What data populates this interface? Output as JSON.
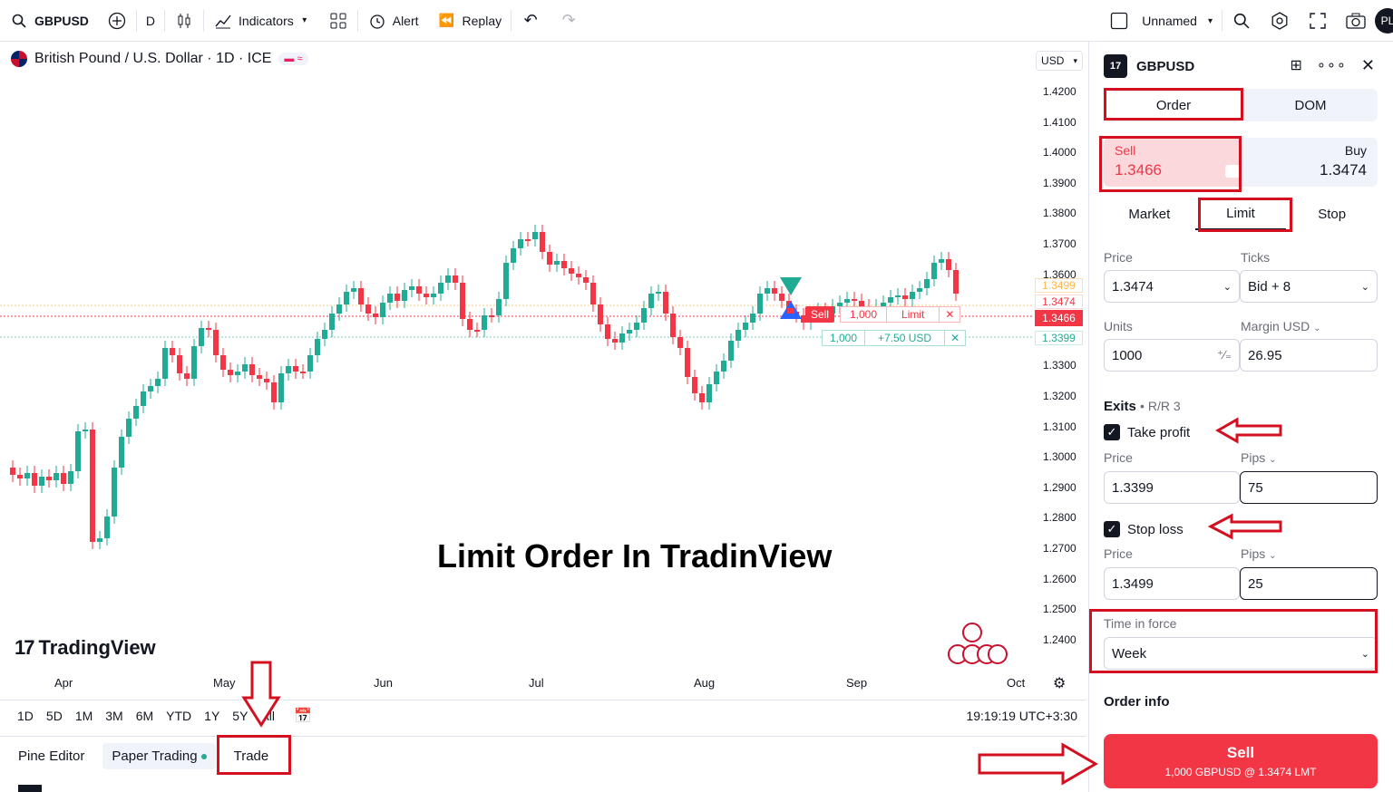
{
  "toolbar": {
    "symbol": "GBPUSD",
    "interval": "D",
    "indicators": "Indicators",
    "alert": "Alert",
    "replay": "Replay",
    "layout": "Unnamed",
    "profile": "PL"
  },
  "legend": {
    "title": "British Pound / U.S. Dollar · 1D · ICE",
    "currency": "USD"
  },
  "price_axis": [
    "1.4200",
    "1.4100",
    "1.4000",
    "1.3900",
    "1.3800",
    "1.3700",
    "1.3600",
    "1.3300",
    "1.3200",
    "1.3100",
    "1.3000",
    "1.2900",
    "1.2800",
    "1.2700",
    "1.2600",
    "1.2500",
    "1.2400"
  ],
  "price_tags": {
    "take_profit": "1.3399",
    "limit": "1.3474",
    "current": "1.3466",
    "stop_loss": "1.3499"
  },
  "chart_lines": {
    "sell_label": "Sell",
    "limit_qty": "1,000",
    "limit_label": "Limit",
    "tp_qty": "1,000",
    "tp_value": "+7.50 USD"
  },
  "months": [
    "Apr",
    "May",
    "Jun",
    "Jul",
    "Aug",
    "Sep",
    "Oct"
  ],
  "watermark": "TradingView",
  "overlay_title": "Limit Order In TradinView",
  "ranges": [
    "1D",
    "5D",
    "1M",
    "3M",
    "6M",
    "YTD",
    "1Y",
    "5Y",
    "All"
  ],
  "clock": "19:19:19 UTC+3:30",
  "bottom_tabs": [
    "Pine Editor",
    "Paper Trading",
    "Trade"
  ],
  "panel": {
    "symbol": "GBPUSD",
    "tabs": [
      "Order",
      "DOM"
    ],
    "sell_label": "Sell",
    "sell_price": "1.3466",
    "buy_label": "Buy",
    "buy_price": "1.3474",
    "order_types": [
      "Market",
      "Limit",
      "Stop"
    ],
    "price_label": "Price",
    "price_value": "1.3474",
    "ticks_label": "Ticks",
    "ticks_value": "Bid + 8",
    "units_label": "Units",
    "units_value": "1000",
    "margin_label": "Margin USD",
    "margin_value": "26.95",
    "exits_label": "Exits",
    "rr_label": "R/R 3",
    "take_profit_label": "Take profit",
    "tp_price_label": "Price",
    "tp_price": "1.3399",
    "tp_pips_label": "Pips",
    "tp_pips": "75",
    "stop_loss_label": "Stop loss",
    "sl_price_label": "Price",
    "sl_price": "1.3499",
    "sl_pips_label": "Pips",
    "sl_pips": "25",
    "tif_label": "Time in force",
    "tif_value": "Week",
    "order_info_label": "Order info",
    "submit_label": "Sell",
    "submit_detail": "1,000 GBPUSD @ 1.3474 LMT"
  },
  "colors": {
    "up": "#22ab94",
    "down": "#f23645",
    "annotation": "#d40f1f"
  }
}
